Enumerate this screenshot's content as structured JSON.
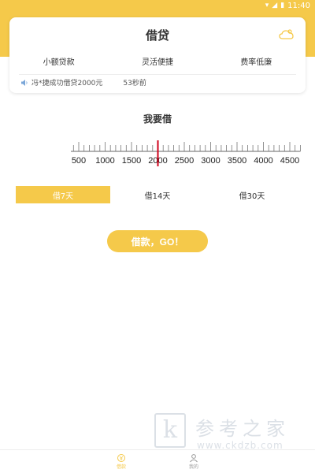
{
  "status_bar": {
    "time": "11:40"
  },
  "card": {
    "title": "借贷",
    "features": [
      "小额贷款",
      "灵活便捷",
      "费率低廉"
    ],
    "notice_text": "冯*捷成功借贷2000元",
    "notice_time": "53秒前"
  },
  "borrow": {
    "label": "我要借",
    "ruler_ticks": [
      "500",
      "1000",
      "1500",
      "2000",
      "2500",
      "3000",
      "3500",
      "4000",
      "4500"
    ],
    "selected_amount": 2000
  },
  "term_tabs": [
    {
      "label": "借7天",
      "active": true
    },
    {
      "label": "借14天",
      "active": false
    },
    {
      "label": "借30天",
      "active": false
    }
  ],
  "go_button": "借款，GO！",
  "watermark": {
    "glyph": "k",
    "text": "参考之家",
    "url": "www.ckdzb.com"
  },
  "bottom_nav": [
    {
      "label": "借款",
      "icon": "loan-icon",
      "active": true
    },
    {
      "label": "我的",
      "icon": "user-icon",
      "active": false
    }
  ],
  "colors": {
    "accent": "#f5c94a",
    "indicator": "#d0021b"
  }
}
